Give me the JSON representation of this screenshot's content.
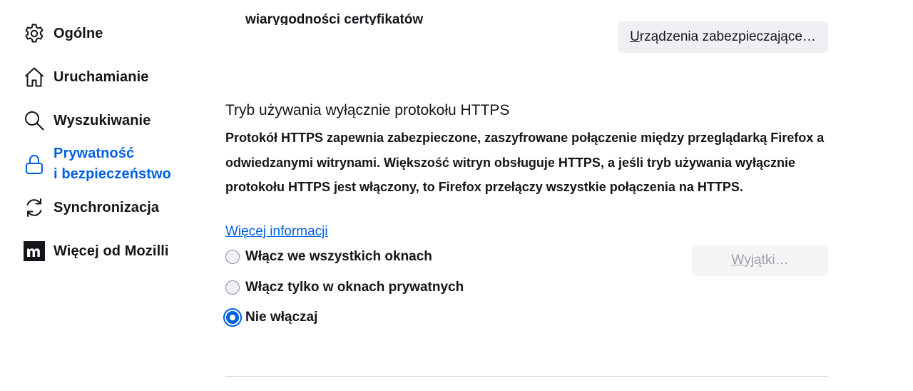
{
  "sidebar": {
    "items": [
      {
        "label": "Ogólne",
        "icon": "gear-icon"
      },
      {
        "label": "Uruchamianie",
        "icon": "home-icon"
      },
      {
        "label": "Wyszukiwanie",
        "icon": "search-icon"
      },
      {
        "label_line1": "Prywatność",
        "label_line2": "i bezpieczeństwo",
        "icon": "lock-icon",
        "selected": true
      },
      {
        "label": "Synchronizacja",
        "icon": "sync-icon"
      },
      {
        "label": "Więcej od Mozilli",
        "icon": "mozilla-logo-icon"
      }
    ]
  },
  "main": {
    "cut_off_text": "wiarygodności certyfikatów",
    "security_devices_button": {
      "label_first_letter": "U",
      "label_rest": "rządzenia zabezpieczające…"
    },
    "https_only": {
      "title": "Tryb używania wyłącznie protokołu HTTPS",
      "description": "Protokół HTTPS zapewnia zabezpieczone, zaszyfrowane połączenie między przeglądarką Firefox a odwiedzanymi witrynami. Większość witryn obsługuje HTTPS, a jeśli tryb używania wyłącznie protokołu HTTPS jest włączony, to Firefox przełączy wszystkie połączenia na HTTPS.",
      "learn_more": "Więcej informacji",
      "options": [
        {
          "label": "Włącz we wszystkich oknach",
          "checked": false
        },
        {
          "label": "Włącz tylko w oknach prywatnych",
          "checked": false
        },
        {
          "label": "Nie włączaj",
          "checked": true
        }
      ],
      "exceptions_button": {
        "label_first_letter": "W",
        "label_rest": "yjątki…",
        "disabled": true
      }
    }
  },
  "colors": {
    "accent": "#0061e0",
    "text": "#15141a",
    "button_bg": "#f0f0f4",
    "disabled_text": "#9f9ea6",
    "divider": "#d7d7db"
  }
}
